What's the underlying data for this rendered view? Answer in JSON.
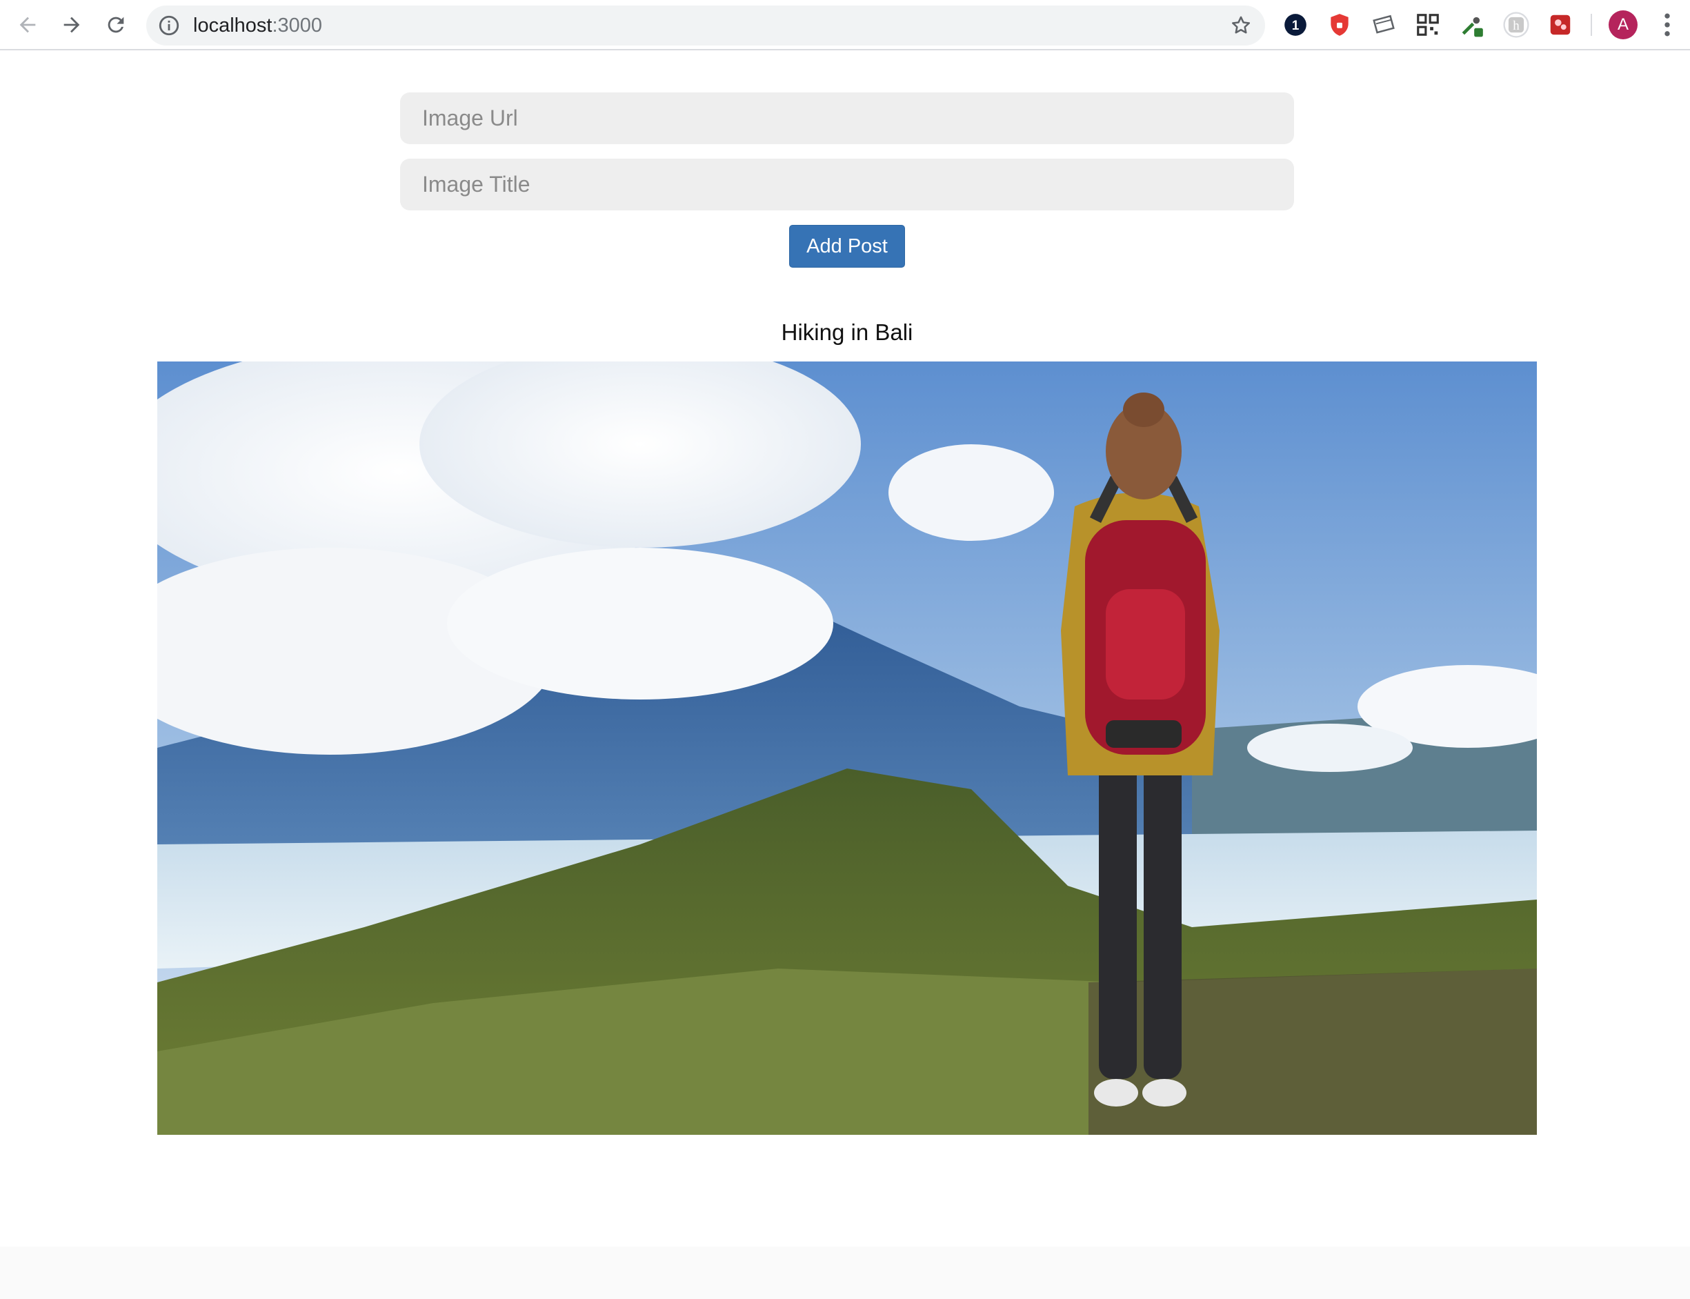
{
  "browser": {
    "url_host": "localhost",
    "url_port": ":3000",
    "profile_initial": "A",
    "icons": {
      "back": "arrow-left-icon",
      "forward": "arrow-right-icon",
      "reload": "reload-icon",
      "site_info": "info-icon",
      "bookmark": "star-icon",
      "menu": "more-vertical-icon"
    },
    "extensions": [
      {
        "name": "1password-extension-icon",
        "glyph": "1"
      },
      {
        "name": "shield-extension-icon"
      },
      {
        "name": "card-extension-icon"
      },
      {
        "name": "qr-code-extension-icon"
      },
      {
        "name": "dropper-extension-icon"
      },
      {
        "name": "h-extension-icon",
        "glyph": "h"
      },
      {
        "name": "puzzle-extension-icon"
      }
    ]
  },
  "form": {
    "url_placeholder": "Image Url",
    "url_value": "",
    "title_placeholder": "Image Title",
    "title_value": "",
    "submit_label": "Add Post"
  },
  "posts": [
    {
      "title": "Hiking in Bali",
      "image_subject": "hiker with red backpack overlooking mountain and lake"
    }
  ],
  "colors": {
    "button": "#3673b5",
    "input_bg": "#eeeeee",
    "avatar": "#b5245c"
  }
}
